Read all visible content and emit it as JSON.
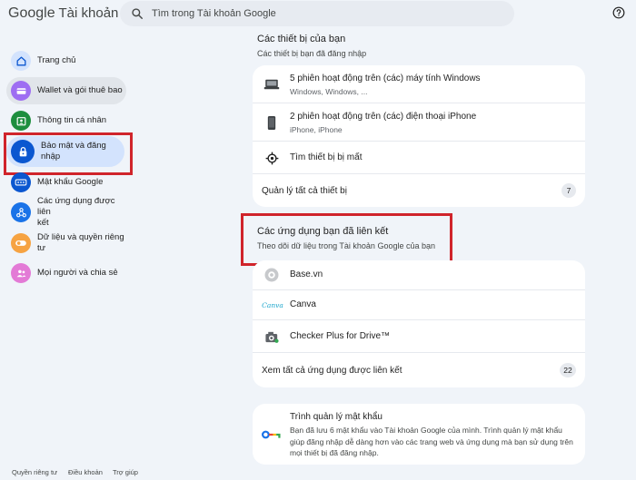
{
  "header": {
    "logo_google": "Google",
    "logo_account": "Tài khoản",
    "search_placeholder": "Tìm trong Tài khoản Google"
  },
  "sidebar": {
    "items": [
      {
        "label": "Trang chủ",
        "icon": "home-icon"
      },
      {
        "label": "Wallet và gói thuê bao",
        "icon": "wallet-icon"
      },
      {
        "label": "Thông tin cá nhân",
        "icon": "id-card-icon"
      },
      {
        "label": "Bảo mật và đăng nhập",
        "icon": "lock-icon"
      },
      {
        "label": "Mật khẩu Google",
        "icon": "password-icon"
      },
      {
        "label_line1": "Các ứng dụng được liên",
        "label_line2": "kết",
        "icon": "connected-apps-icon"
      },
      {
        "label": "Dữ liệu và quyền riêng tư",
        "icon": "toggle-icon"
      },
      {
        "label": "Mọi người và chia sẻ",
        "icon": "people-icon"
      }
    ]
  },
  "devices": {
    "title": "Các thiết bị của bạn",
    "subtitle": "Các thiết bị bạn đã đăng nhập",
    "items": [
      {
        "title": "5 phiên hoạt động trên (các) máy tính Windows",
        "subtitle": "Windows, Windows, ...",
        "icon": "laptop-icon"
      },
      {
        "title": "2 phiên hoạt động trên (các) điện thoại iPhone",
        "subtitle": "iPhone, iPhone",
        "icon": "phone-icon"
      },
      {
        "title": "Tìm thiết bị bị mất",
        "icon": "locate-icon"
      }
    ],
    "manage_label": "Quản lý tất cả thiết bị",
    "manage_count": "7"
  },
  "linked_apps": {
    "title": "Các ứng dụng bạn đã liên kết",
    "subtitle": "Theo dõi dữ liệu trong Tài khoản Google của bạn",
    "items": [
      {
        "name": "Base.vn",
        "icon": "base-vn-icon"
      },
      {
        "name": "Canva",
        "icon": "canva-logo-icon",
        "logo_text": "Canva"
      },
      {
        "name": "Checker Plus for Drive™",
        "icon": "checker-plus-icon"
      }
    ],
    "see_all_label": "Xem tất cả ứng dụng được liên kết",
    "see_all_count": "22"
  },
  "password_manager": {
    "title": "Trình quản lý mật khẩu",
    "description": "Bạn đã lưu 6 mật khẩu vào Tài khoản Google của mình. Trình quản lý mật khẩu giúp đăng nhập dễ dàng hơn vào các trang web và ứng dụng mà bạn sử dụng trên mọi thiết bị đã đăng nhập.",
    "icon": "key-icon"
  },
  "footer": {
    "privacy": "Quyền riêng tư",
    "terms": "Điều khoản",
    "help": "Trợ giúp"
  },
  "colors": {
    "highlight": "#d0242b",
    "background": "#f0f4f9",
    "active": "#d3e3fd"
  }
}
